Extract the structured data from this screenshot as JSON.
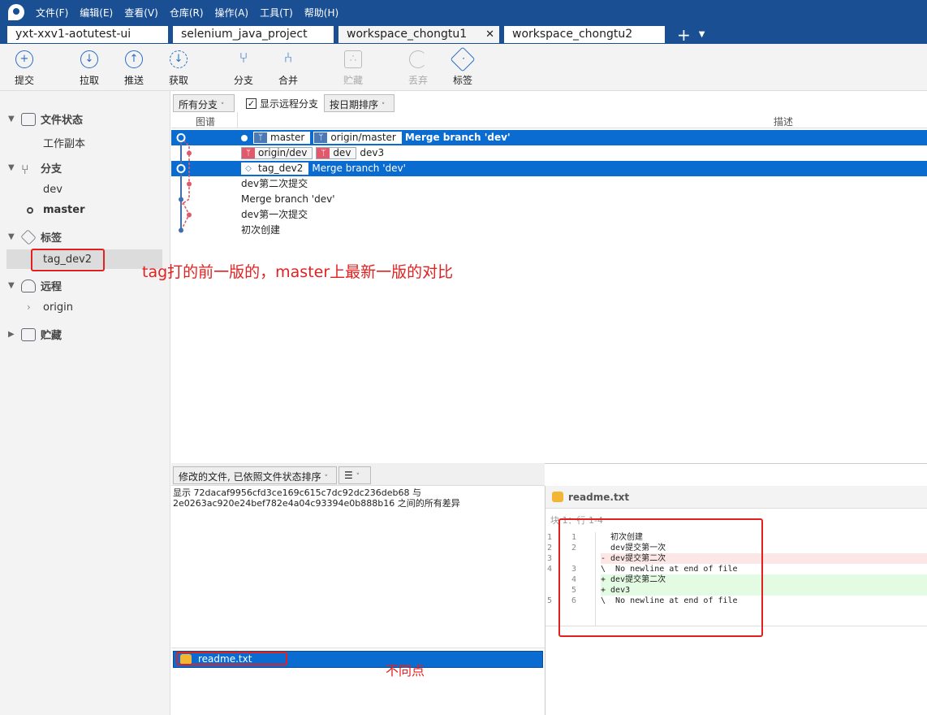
{
  "menu": [
    "文件(F)",
    "编辑(E)",
    "查看(V)",
    "仓库(R)",
    "操作(A)",
    "工具(T)",
    "帮助(H)"
  ],
  "tabs": [
    "yxt-xxv1-aotutest-ui",
    "selenium_java_project",
    "workspace_chongtu1",
    "workspace_chongtu2"
  ],
  "active_tab": "workspace_chongtu1",
  "toolbar": [
    {
      "label": "提交",
      "icon": "plus-circle-icon"
    },
    {
      "label": "拉取",
      "icon": "arrow-down-circle-icon"
    },
    {
      "label": "推送",
      "icon": "arrow-up-circle-icon"
    },
    {
      "label": "获取",
      "icon": "fetch-icon"
    },
    {
      "label": "分支",
      "icon": "branch-icon"
    },
    {
      "label": "合并",
      "icon": "merge-icon"
    },
    {
      "label": "贮藏",
      "icon": "stash-icon",
      "disabled": true
    },
    {
      "label": "丢弃",
      "icon": "discard-icon",
      "disabled": true
    },
    {
      "label": "标签",
      "icon": "tag-icon"
    }
  ],
  "sidebar": {
    "file_status": "文件状态",
    "working_copy": "工作副本",
    "branches": "分支",
    "dev": "dev",
    "master": "master",
    "tags": "标签",
    "tag_dev2": "tag_dev2",
    "remotes": "远程",
    "origin": "origin",
    "stash": "贮藏"
  },
  "filters": {
    "branches": "所有分支",
    "show_remote": "显示远程分支",
    "show_remote_checked": true,
    "sort": "按日期排序"
  },
  "columns": {
    "graph": "图谱",
    "description": "描述"
  },
  "commits": [
    {
      "labels": [
        "master",
        "origin/master"
      ],
      "message": "Merge branch 'dev'",
      "selected": true
    },
    {
      "labels": [
        "origin/dev",
        "dev"
      ],
      "message": "dev3"
    },
    {
      "labels": [
        "tag_dev2"
      ],
      "message": "Merge branch 'dev'",
      "selected": true
    },
    {
      "labels": [],
      "message": "dev第二次提交"
    },
    {
      "labels": [],
      "message": "Merge branch 'dev'"
    },
    {
      "labels": [],
      "message": "dev第一次提交"
    },
    {
      "labels": [],
      "message": "初次创建"
    }
  ],
  "annotation1": "tag打的前一版的，master上最新一版的对比",
  "annotation2": "不同点",
  "bottom": {
    "sort": "修改的文件, 已依照文件状态排序",
    "diff_info_1": "显示 72dacaf9956cfd3ce169c615c7dc92dc236deb68 与",
    "diff_info_2": "2e0263ac920e24bef782e4a04c93394e0b888b16 之间的所有差异",
    "file": "readme.txt"
  },
  "diff": {
    "file": "readme.txt",
    "hunk": "块 1：行 1-4",
    "lines": [
      {
        "o": "1",
        "n": "1",
        "t": "  初次创建",
        "k": "ctx"
      },
      {
        "o": "2",
        "n": "2",
        "t": "  dev提交第一次",
        "k": "ctx"
      },
      {
        "o": "3",
        "n": "",
        "t": "- dev提交第二次",
        "k": "del"
      },
      {
        "o": "4",
        "n": "3",
        "t": "\\  No newline at end of file",
        "k": "ctx"
      },
      {
        "o": "",
        "n": "4",
        "t": "+ dev提交第二次",
        "k": "add"
      },
      {
        "o": "",
        "n": "5",
        "t": "+ dev3",
        "k": "add"
      },
      {
        "o": "5",
        "n": "6",
        "t": "\\  No newline at end of file",
        "k": "ctx"
      }
    ]
  },
  "colors": {
    "accent": "#0a6cd0",
    "menubar": "#1b4f94",
    "graph_master": "#3f6fb0",
    "graph_dev": "#e05a6c",
    "annotation": "#e32020"
  }
}
